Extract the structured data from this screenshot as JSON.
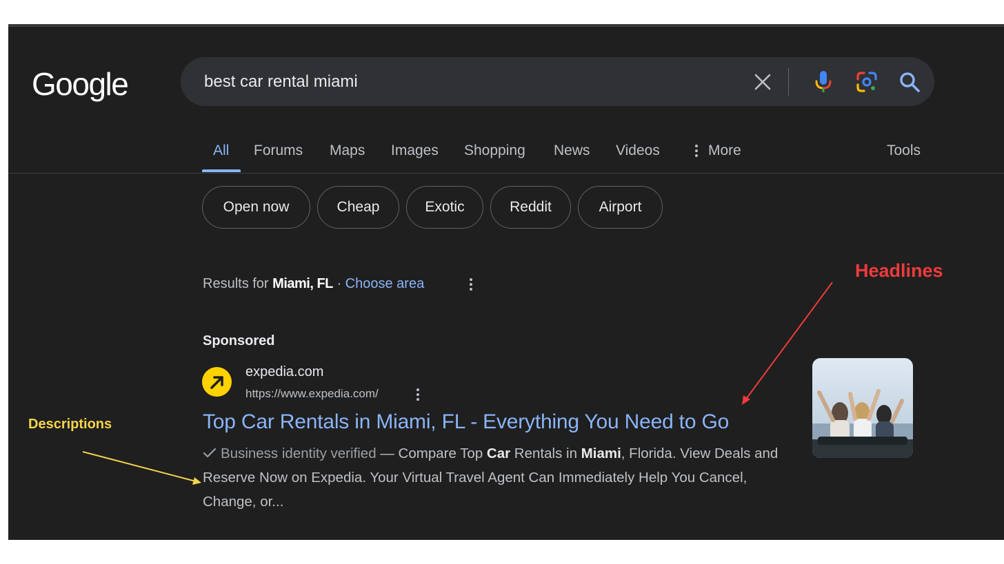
{
  "logo": {
    "text": "Google"
  },
  "search": {
    "query": "best car rental miami"
  },
  "icons": {
    "clear": "close-icon",
    "mic": "mic-icon",
    "lens": "lens-icon",
    "search": "search-icon",
    "more": "more-vertical-icon"
  },
  "tabs": [
    {
      "label": "All",
      "active": true
    },
    {
      "label": "Forums"
    },
    {
      "label": "Maps"
    },
    {
      "label": "Images"
    },
    {
      "label": "Shopping"
    },
    {
      "label": "News"
    },
    {
      "label": "Videos"
    },
    {
      "label": "More"
    }
  ],
  "tools": "Tools",
  "chips": [
    "Open now",
    "Cheap",
    "Exotic",
    "Reddit",
    "Airport"
  ],
  "location": {
    "prefix": "Results for ",
    "place": "Miami, FL",
    "separator": " · ",
    "choose": "Choose area"
  },
  "ad": {
    "sponsored": "Sponsored",
    "site_name": "expedia.com",
    "site_url": "https://www.expedia.com/",
    "headline": "Top Car Rentals in Miami, FL - Everything You Need to Go",
    "verified": "Business identity verified",
    "dash": " — ",
    "desc_1": "Compare Top ",
    "desc_b1": "Car",
    "desc_2": " Rentals in ",
    "desc_b2": "Miami",
    "desc_3": ", Florida. View Deals and Reserve Now on Expedia. Your Virtual Travel Agent Can Immediately Help You Cancel, Change, or..."
  },
  "annotations": {
    "headlines": "Headlines",
    "descriptions": "Descriptions"
  },
  "colors": {
    "background": "#1f1f1f",
    "link": "#8ab4f8",
    "headline_annotation": "#ee3b3b",
    "description_annotation": "#f5d44a",
    "favicon": "#ffd200"
  }
}
